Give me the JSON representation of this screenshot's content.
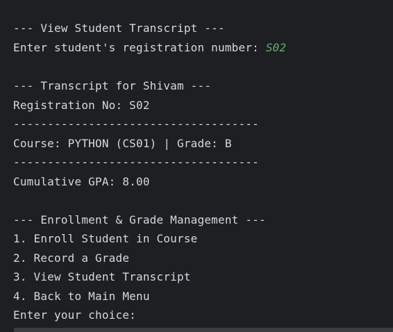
{
  "console": {
    "lines": [
      "--- View Student Transcript ---",
      "Enter student's registration number: ",
      "",
      "--- Transcript for Shivam ---",
      "Registration No: S02",
      "------------------------------------",
      "Course: PYTHON (CS01) | Grade: B",
      "------------------------------------",
      "Cumulative GPA: 8.00",
      "",
      "--- Enrollment & Grade Management ---",
      "1. Enroll Student in Course",
      "2. Record a Grade",
      "3. View Student Transcript",
      "4. Back to Main Menu",
      "Enter your choice: "
    ],
    "user_input": "S02"
  },
  "colors": {
    "background": "#1e1f22",
    "text": "#d5d8de",
    "user_input": "#6aab73"
  }
}
